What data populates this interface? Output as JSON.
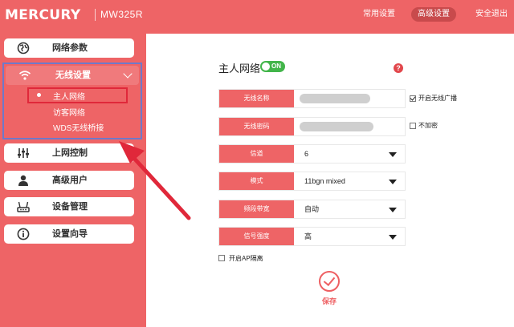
{
  "header": {
    "brand": "MERCURY",
    "model": "MW325R",
    "nav": {
      "basic": "常用设置",
      "advanced": "高级设置",
      "logout": "安全退出"
    }
  },
  "sidebar": {
    "network": "网络参数",
    "wireless": "无线设置",
    "wireless_sub": [
      "主人网络",
      "访客网络",
      "WDS无线桥接"
    ],
    "parental": "上网控制",
    "advanced_user": "高级用户",
    "device_mgmt": "设备管理",
    "wizard": "设置向导"
  },
  "panel": {
    "title": "主人网络",
    "toggle": "ON",
    "help": "?",
    "fields": [
      {
        "label": "无线名称",
        "value": ""
      },
      {
        "label": "无线密码",
        "value": ""
      },
      {
        "label": "信道",
        "value": "6"
      },
      {
        "label": "模式",
        "value": "11bgn mixed"
      },
      {
        "label": "频段带宽",
        "value": "自动"
      },
      {
        "label": "信号强度",
        "value": "高"
      }
    ],
    "broadcast_label": "开启无线广播",
    "no_encrypt_label": "不加密",
    "ap_isolation_label": "开启AP隔离",
    "save_label": "保存"
  },
  "colors": {
    "brand_red": "#ee6466",
    "highlight_blue": "#6f79c9",
    "highlight_red": "#e0283a",
    "toggle_green": "#42b54a"
  }
}
